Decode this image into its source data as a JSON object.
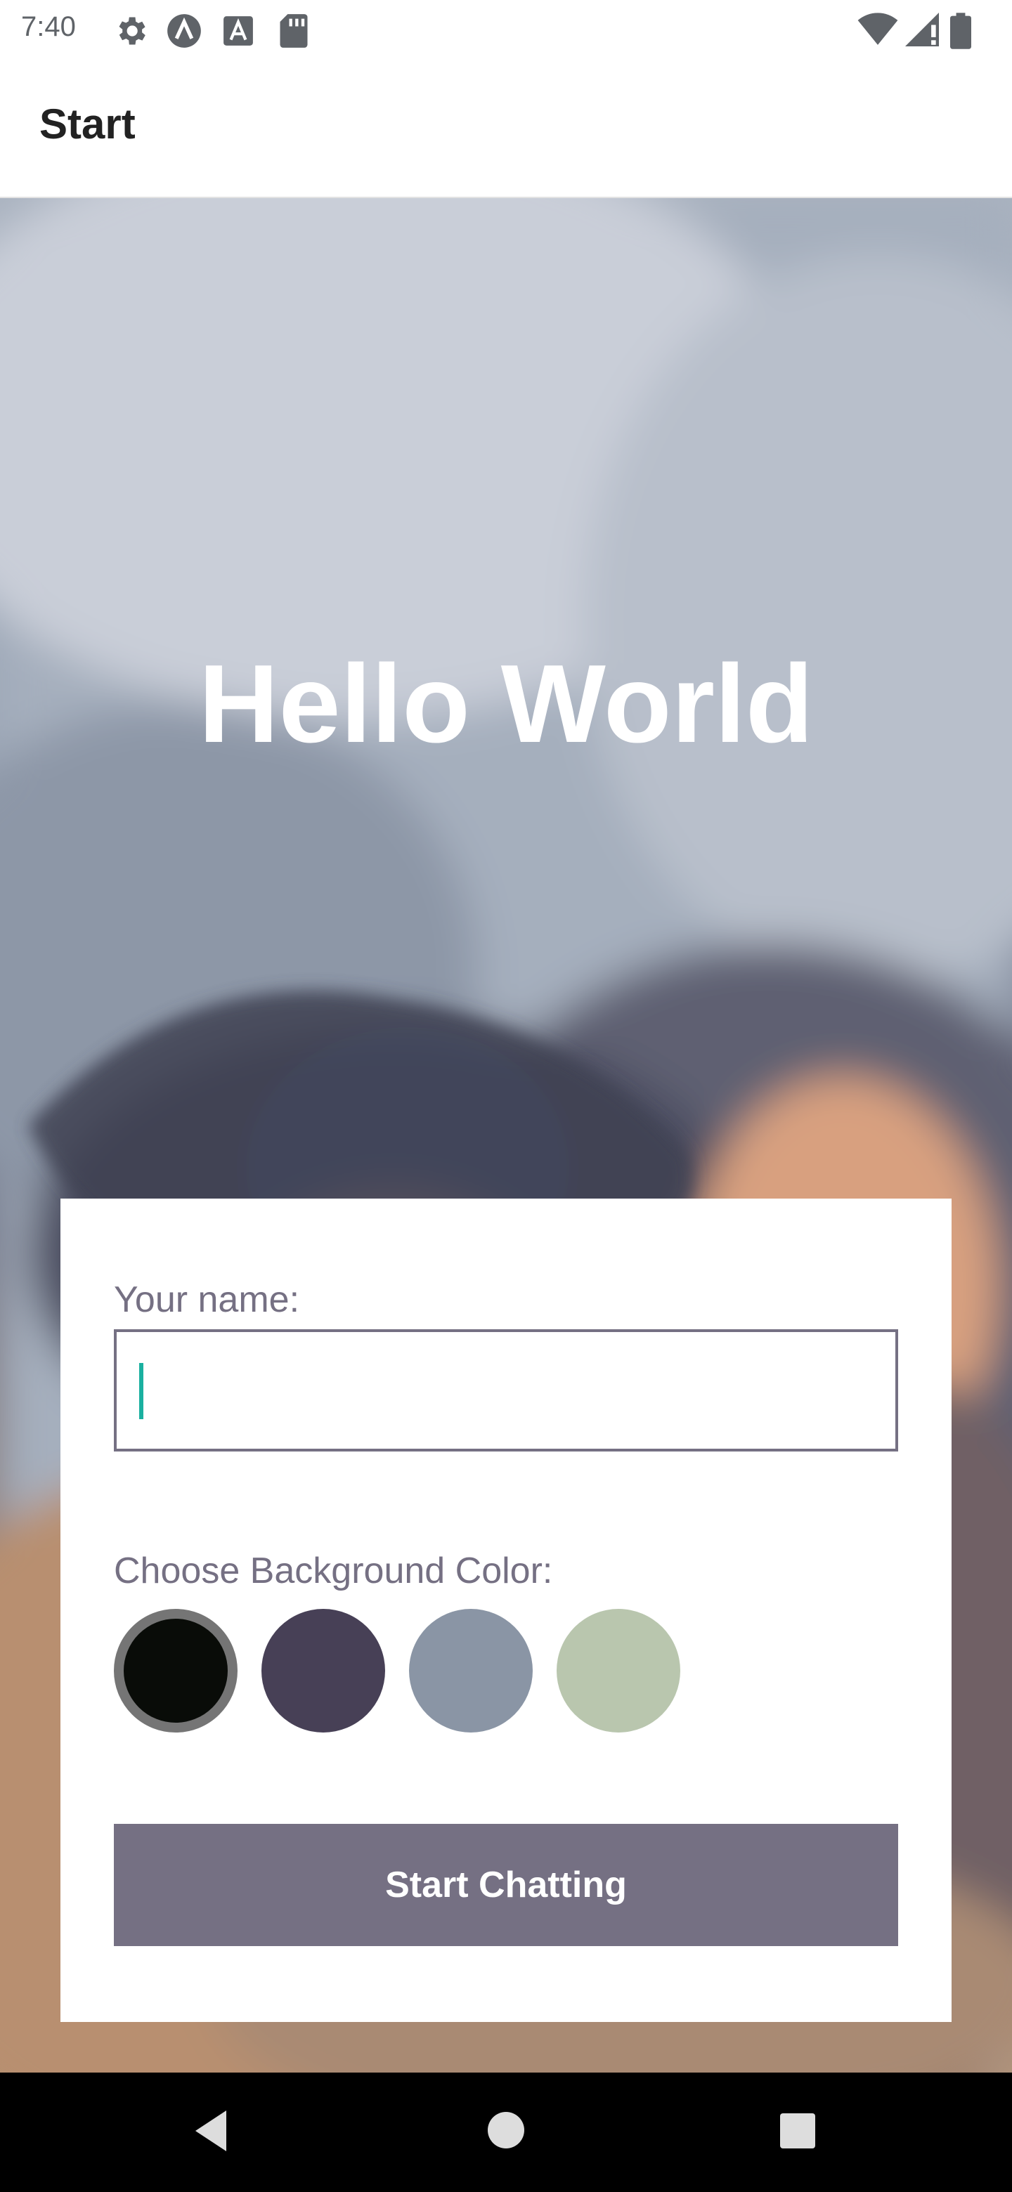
{
  "status_bar": {
    "time": "7:40",
    "left_icons": [
      "settings-icon",
      "a-circle-icon",
      "a-square-icon",
      "sd-card-icon"
    ],
    "right_icons": [
      "wifi-icon",
      "signal-icon",
      "battery-icon"
    ]
  },
  "app_bar": {
    "title": "Start"
  },
  "hero": {
    "title": "Hello World"
  },
  "form": {
    "name_label": "Your name:",
    "name_value": "",
    "color_label": "Choose Background Color:",
    "colors": [
      "#090C08",
      "#474056",
      "#8A95A5",
      "#B9C6AE"
    ],
    "selected_color_index": 0,
    "button_label": "Start Chatting",
    "button_color": "#757083"
  },
  "nav_bar": {
    "buttons": [
      "back-icon",
      "home-icon",
      "recents-icon"
    ]
  }
}
